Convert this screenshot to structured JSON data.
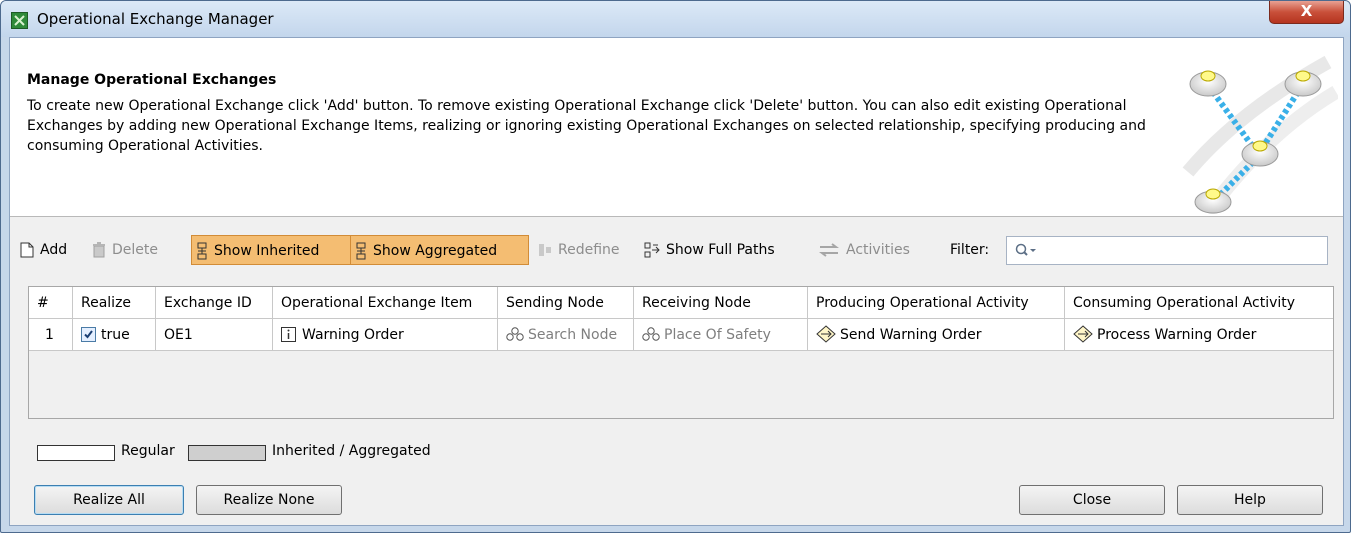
{
  "window": {
    "title": "Operational Exchange Manager",
    "close_glyph": "X"
  },
  "header": {
    "title": "Manage Operational Exchanges",
    "description": "To create new Operational Exchange click 'Add' button. To remove existing Operational Exchange click 'Delete' button. You can also edit existing Operational Exchanges by adding new Operational Exchange Items, realizing or ignoring existing Operational Exchanges on selected relationship, specifying producing and consuming Operational Activities."
  },
  "toolbar": {
    "add": "Add",
    "delete": "Delete",
    "show_inherited": "Show Inherited",
    "show_aggregated": "Show Aggregated",
    "redefine": "Redefine",
    "show_full_paths": "Show Full Paths",
    "activities": "Activities",
    "filter_label": "Filter:",
    "filter_value": ""
  },
  "table": {
    "columns": [
      "#",
      "Realize",
      "Exchange ID",
      "Operational Exchange Item",
      "Sending Node",
      "Receiving Node",
      "Producing Operational Activity",
      "Consuming Operational Activity"
    ],
    "rows": [
      {
        "num": "1",
        "realize_checked": true,
        "realize": "true",
        "exchange_id": "OE1",
        "item": "Warning Order",
        "sending_node": "Search Node",
        "receiving_node": "Place Of Safety",
        "producing": "Send Warning Order",
        "consuming": "Process Warning Order"
      }
    ]
  },
  "legend": {
    "regular": "Regular",
    "inherited": "Inherited / Aggregated"
  },
  "buttons": {
    "realize_all": "Realize All",
    "realize_none": "Realize None",
    "close": "Close",
    "help": "Help"
  },
  "colors": {
    "toggle_active": "#f4bd72",
    "inherited_swatch": "#cfcfcf",
    "close_button": "#c9503a"
  },
  "icons": {
    "app": "operational-exchange-icon",
    "add": "new-document-icon",
    "delete": "trash-icon",
    "show_inherited": "hierarchy-icon",
    "show_aggregated": "hierarchy-icon",
    "redefine": "redefine-icon",
    "show_full_paths": "full-paths-icon",
    "activities": "exchange-arrows-icon",
    "filter": "search-icon",
    "item": "information-item-icon",
    "node": "node-icon",
    "activity": "activity-icon"
  }
}
